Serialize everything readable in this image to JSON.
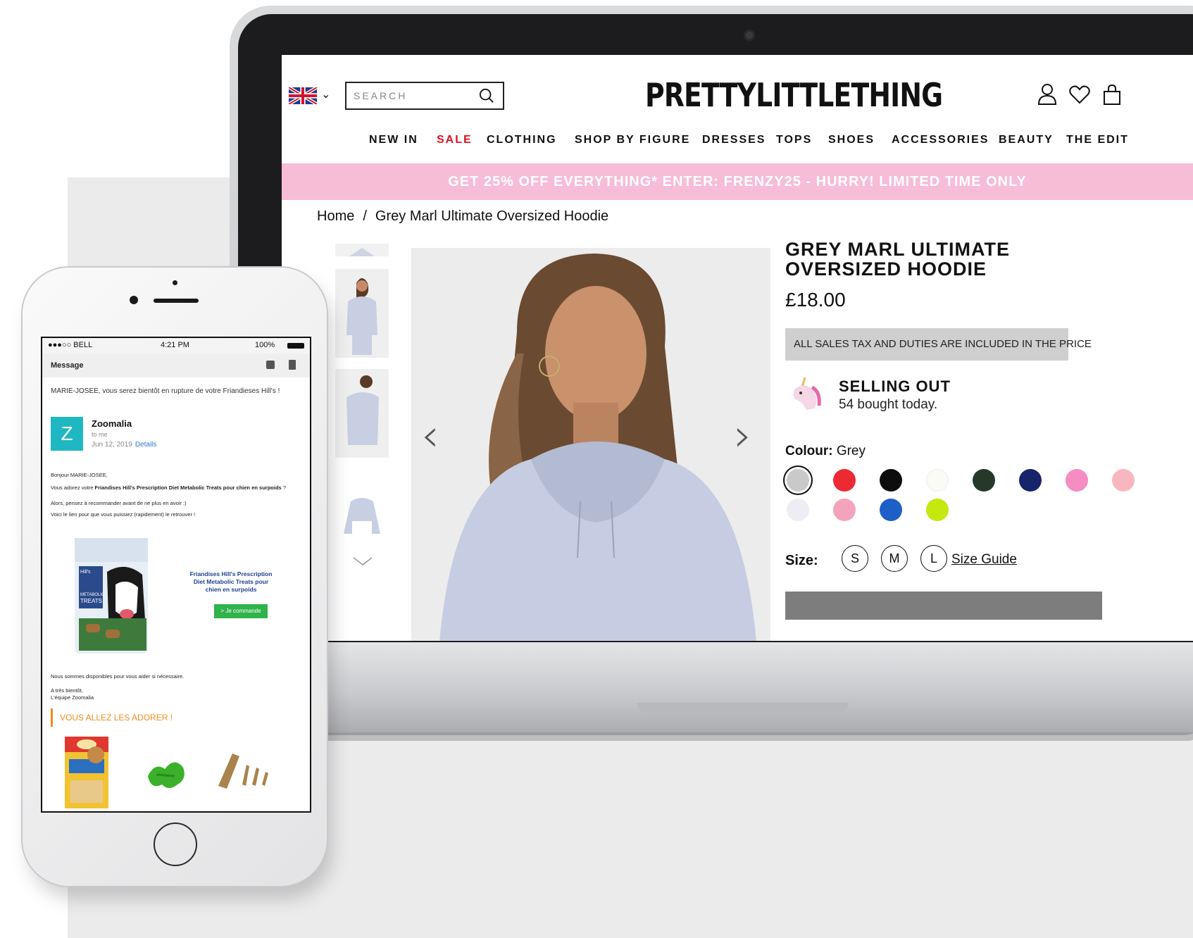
{
  "laptop": {
    "search": {
      "placeholder": "SEARCH"
    },
    "brand": "PRETTYLITTLETHING",
    "nav": [
      "NEW IN",
      "SALE",
      "CLOTHING",
      "SHOP BY FIGURE",
      "DRESSES",
      "TOPS",
      "SHOES",
      "ACCESSORIES",
      "BEAUTY",
      "THE EDIT"
    ],
    "promo": "GET 25% OFF EVERYTHING* ENTER: FRENZY25 - HURRY! LIMITED TIME ONLY",
    "breadcrumb": {
      "home": "Home",
      "sep": "/",
      "current": "Grey Marl Ultimate Oversized Hoodie"
    },
    "product": {
      "title": "GREY MARL ULTIMATE OVERSIZED HOODIE",
      "price": "£18.00",
      "tax_note": "ALL SALES TAX AND DUTIES ARE INCLUDED IN THE PRICE",
      "selling_title": "SELLING OUT",
      "selling_sub": "54 bought today.",
      "colour_label": "Colour:",
      "colour_value": "Grey",
      "swatches": [
        "#c9c9c9",
        "#ec2a33",
        "#0d0d0d",
        "#fbfbf6",
        "#26382a",
        "#17246b",
        "#f58cc2",
        "#f8b7bf",
        "#ededf3",
        "#f3a3bb",
        "#1c5fc6",
        "#c5e80e"
      ],
      "size_label": "Size:",
      "sizes": [
        "S",
        "M",
        "L"
      ],
      "size_guide": "Size Guide"
    },
    "colors": {
      "accent_sale": "#e0101f",
      "promo_bg": "#f7bcd6"
    }
  },
  "phone": {
    "status": {
      "carrier": "●●●○○ BELL",
      "time": "4:21 PM",
      "battery": "100%"
    },
    "header_title": "Message",
    "subject": "MARIE-JOSEE, vous serez bientôt en rupture de votre Friandieses Hill's !",
    "email": {
      "avatar_letter": "Z",
      "sender": "Zoomalia",
      "to": "to me",
      "date": "Jun 12, 2019",
      "details": "Details",
      "greeting": "Bonjour MARIE-JOSEE,",
      "para1_a": "Vous adorez votre ",
      "para1_b": "Friandises Hill's Prescription Diet Metabolic Treats pour chien en surpoids",
      "para1_c": " ?",
      "para2": "Alors, pensez à recommander avant de ne plus en avoir :)",
      "para3": "Voici le lien pour que vous puissiez (rapidement) le retrouver !",
      "cta_title": "Friandises Hill's Prescription Diet Metabolic Treats pour chien en surpoids",
      "cta_button": "> Je commande",
      "help": "Nous sommes disponibles pour vous aider si nécessaire.",
      "signoff1": "A très bientôt,",
      "signoff2": "L'équipe Zoomalia",
      "section": "VOUS ALLEZ LES ADORER !",
      "package_brand": "Hill's",
      "package_label_1": "METABOLIC",
      "package_label_2": "TREATS"
    }
  }
}
